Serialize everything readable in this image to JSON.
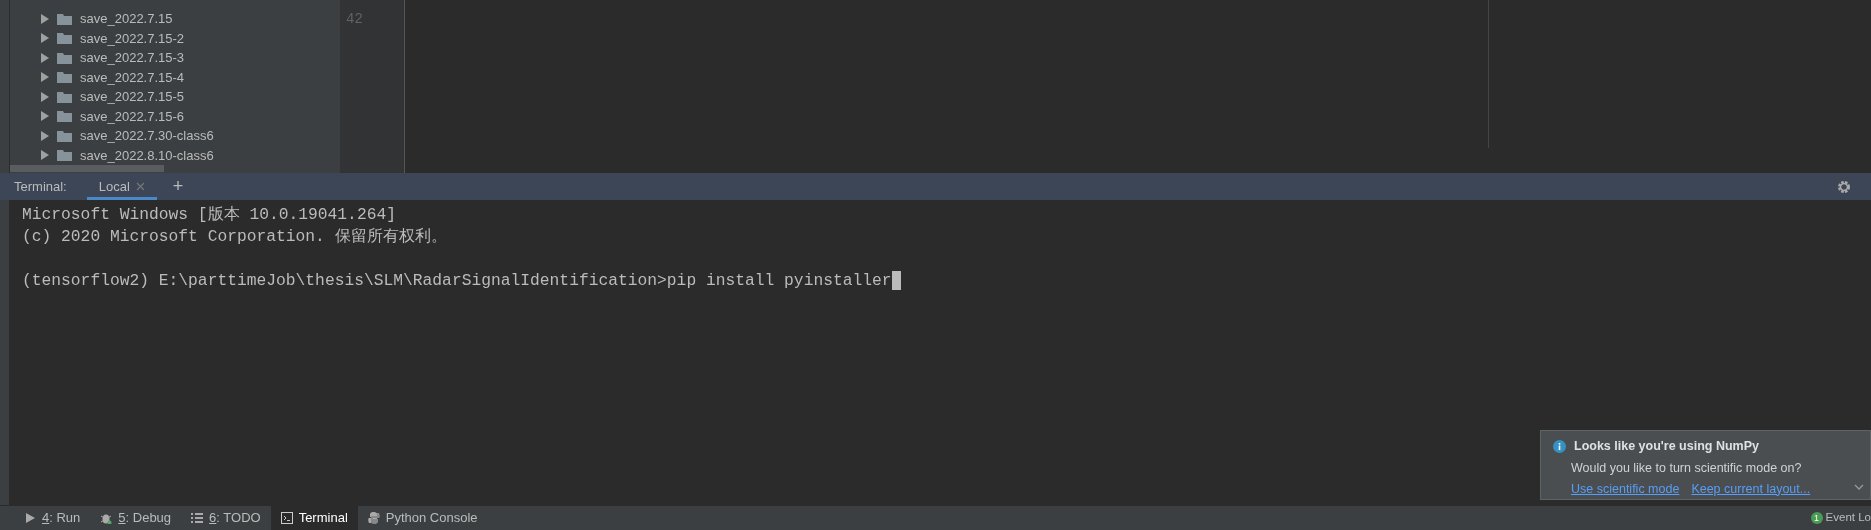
{
  "project_tree": {
    "items": [
      {
        "label": "save_2022.7.15",
        "expanded": false
      },
      {
        "label": "save_2022.7.15-2",
        "expanded": false
      },
      {
        "label": "save_2022.7.15-3",
        "expanded": false
      },
      {
        "label": "save_2022.7.15-4",
        "expanded": false
      },
      {
        "label": "save_2022.7.15-5",
        "expanded": false
      },
      {
        "label": "save_2022.7.15-6",
        "expanded": false
      },
      {
        "label": "save_2022.7.30-class6",
        "expanded": false
      },
      {
        "label": "save_2022.8.10-class6",
        "expanded": false
      }
    ]
  },
  "editor": {
    "lines": [
      {
        "number": "42"
      }
    ]
  },
  "terminal": {
    "label": "Terminal:",
    "tabs": [
      {
        "label": "Local",
        "selected": true
      }
    ],
    "add": "+",
    "lines": [
      "Microsoft Windows [版本 10.0.19041.264]",
      "(c) 2020 Microsoft Corporation. 保留所有权利。"
    ],
    "prompt": "(tensorflow2) E:\\parttimeJob\\thesis\\SLM\\RadarSignalIdentification>pip install pyinstaller"
  },
  "notification": {
    "title": "Looks like you're using NumPy",
    "message": "Would you like to turn scientific mode on?",
    "actions": [
      "Use scientific mode",
      "Keep current layout..."
    ]
  },
  "tool_windows": [
    {
      "number": "4",
      "label": ": Run",
      "kind": "run",
      "selected": false
    },
    {
      "number": "5",
      "label": ": Debug",
      "kind": "debug",
      "selected": false
    },
    {
      "number": "6",
      "label": ": TODO",
      "kind": "todo",
      "selected": false
    },
    {
      "label": "Terminal",
      "kind": "terminal",
      "selected": true
    },
    {
      "label": "Python Console",
      "kind": "python",
      "selected": false
    }
  ],
  "status_bar": {
    "event_count": "1",
    "event_label": "Event Lo"
  }
}
